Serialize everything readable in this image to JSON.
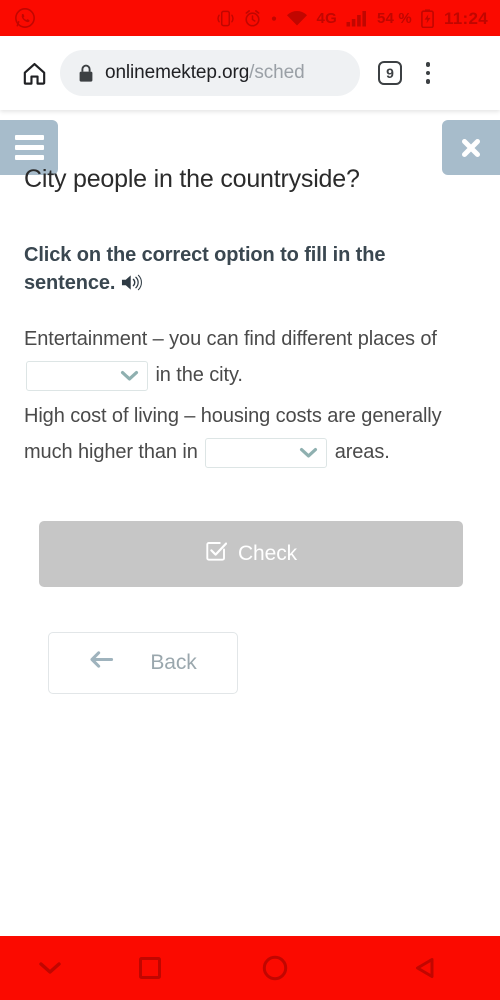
{
  "status_bar": {
    "notification_icon": "whatsapp-icon",
    "icons": [
      "vibrate-icon",
      "alarm-icon",
      "dot-icon",
      "wifi-icon"
    ],
    "network": "4G",
    "signal_icon": "signal-bars-icon",
    "battery_percent": "54 %",
    "battery_icon": "battery-icon",
    "clock": "11:24",
    "background_color": "#fb0a00",
    "icon_color": "#c10600"
  },
  "browser": {
    "home_icon": "home-icon",
    "lock_icon": "lock-icon",
    "url_domain": "onlinemektep.org",
    "url_path": "/sched",
    "tab_count": "9",
    "menu_icon": "overflow-menu-icon"
  },
  "page": {
    "menu_button_icon": "hamburger-menu-icon",
    "close_button_icon": "close-x-icon",
    "control_color": "#a7bccb",
    "title": "City people in the countryside?",
    "instruction": "Click on the correct option to fill in the sentence.",
    "audio_icon": "speaker-icon",
    "questions": [
      {
        "text_before": "Entertainment – you can find different places of",
        "select_value": "",
        "select_icon": "chevron-down-icon",
        "text_after": "in the city."
      },
      {
        "text_before": "High cost of living – housing costs are generally much higher than in",
        "select_value": "",
        "select_icon": "chevron-down-icon",
        "text_after": "areas."
      }
    ],
    "check_button": {
      "label": "Check",
      "icon": "checkbox-check-icon",
      "background_color": "#c6c6c6",
      "text_color": "#ffffff"
    },
    "back_button": {
      "label": "Back",
      "icon": "arrow-left-icon",
      "text_color": "#9aa7ad"
    }
  },
  "nav_bar": {
    "background_color": "#fb0a00",
    "icon_color": "#c10600",
    "buttons": [
      {
        "name": "hide-keyboard-icon"
      },
      {
        "name": "recents-square-icon"
      },
      {
        "name": "home-circle-icon"
      },
      {
        "name": "back-triangle-icon"
      }
    ]
  }
}
